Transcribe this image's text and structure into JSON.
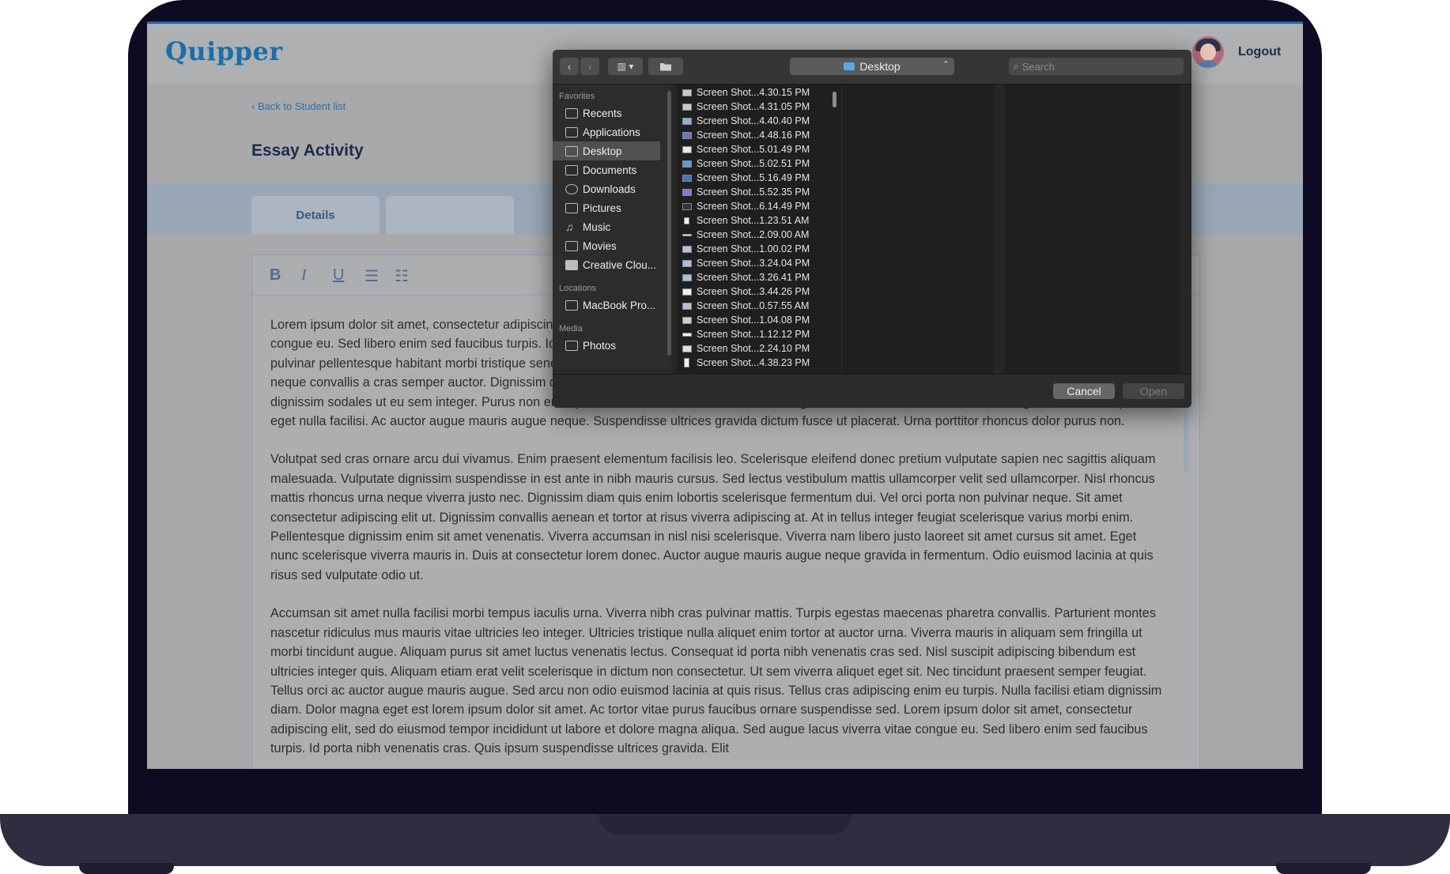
{
  "app": {
    "logo": "Quipper",
    "logout_label": "Logout",
    "back_link": "‹  Back to Student list",
    "page_title": "Essay Activity",
    "tabs": [
      {
        "label": "Details"
      },
      {
        "label": ""
      }
    ],
    "toolbar": {
      "bold": "B",
      "italic": "I",
      "underline": "U",
      "bullets": "☰",
      "numbered": "☷"
    },
    "essay": [
      "Lorem ipsum dolor sit amet, consectetur adipiscing elit, sed do eiusmod tempor incididunt ut labore et dolore magna aliqua. Sed augue lacus viverra vitae congue eu. Sed libero enim sed faucibus turpis. Id porta nibh venenatis cras. Quis ipsum suspendisse ultrices gravida. Elit scelerisque mauris pellentesque pulvinar pellentesque habitant morbi tristique senectus. Scelerisque mauris pellentesque pulvinar pellentesque habitant. Bibendum enim facilisis gravida neque convallis a cras semper auctor. Dignissim diam quis enim lobortis scelerisque fermentum dui faucibus in. Euismod in pellentesque. Nunc sed velit dignissim sodales ut eu sem integer. Purus non enim praesent elementum facilisis leo vel fringilla est. Elementum facilisis leo vel fringilla est ullamcorper eget nulla facilisi. Ac auctor augue mauris augue neque. Suspendisse ultrices gravida dictum fusce ut placerat. Urna porttitor rhoncus dolor purus non.",
      "Volutpat sed cras ornare arcu dui vivamus. Enim praesent elementum facilisis leo. Scelerisque eleifend donec pretium vulputate sapien nec sagittis aliquam malesuada. Vulputate dignissim suspendisse in est ante in nibh mauris cursus. Sed lectus vestibulum mattis ullamcorper velit sed ullamcorper. Nisl rhoncus mattis rhoncus urna neque viverra justo nec. Dignissim diam quis enim lobortis scelerisque fermentum dui. Vel orci porta non pulvinar neque. Sit amet consectetur adipiscing elit ut. Dignissim convallis aenean et tortor at risus viverra adipiscing at. At in tellus integer feugiat scelerisque varius morbi enim. Pellentesque dignissim enim sit amet venenatis. Viverra accumsan in nisl nisi scelerisque. Viverra nam libero justo laoreet sit amet cursus sit amet. Eget nunc scelerisque viverra mauris in. Duis at consectetur lorem donec. Auctor augue mauris augue neque gravida in fermentum. Odio euismod lacinia at quis risus sed vulputate odio ut.",
      "Accumsan sit amet nulla facilisi morbi tempus iaculis urna. Viverra nibh cras pulvinar mattis. Turpis egestas maecenas pharetra convallis. Parturient montes nascetur ridiculus mus mauris vitae ultricies leo integer. Ultricies tristique nulla aliquet enim tortor at auctor urna. Viverra mauris in aliquam sem fringilla ut morbi tincidunt augue. Aliquam purus sit amet luctus venenatis lectus. Consequat id porta nibh venenatis cras sed. Nisl suscipit adipiscing bibendum est ultricies integer quis. Aliquam etiam erat velit scelerisque in dictum non consectetur. Ut sem viverra aliquet eget sit. Nec tincidunt praesent semper feugiat. Tellus orci ac auctor augue mauris augue. Sed arcu non odio euismod lacinia at quis risus. Tellus cras adipiscing enim eu turpis. Nulla facilisi etiam dignissim diam. Dolor magna eget est lorem ipsum dolor sit amet. Ac tortor vitae purus faucibus ornare suspendisse sed. Lorem ipsum dolor sit amet, consectetur adipiscing elit, sed do eiusmod tempor incididunt ut labore et dolore magna aliqua. Sed augue lacus viverra vitae congue eu. Sed libero enim sed faucibus turpis. Id porta nibh venenatis cras. Quis ipsum suspendisse ultrices gravida. Elit"
    ]
  },
  "dialog": {
    "location": "Desktop",
    "search_placeholder": "Search",
    "sidebar": {
      "favorites_heading": "Favorites",
      "favorites": [
        {
          "label": "Recents",
          "icon": "clock-icon",
          "selected": false
        },
        {
          "label": "Applications",
          "icon": "applications-icon",
          "selected": false
        },
        {
          "label": "Desktop",
          "icon": "desktop-icon",
          "selected": true
        },
        {
          "label": "Documents",
          "icon": "document-icon",
          "selected": false
        },
        {
          "label": "Downloads",
          "icon": "download-icon",
          "selected": false
        },
        {
          "label": "Pictures",
          "icon": "camera-icon",
          "selected": false
        },
        {
          "label": "Music",
          "icon": "music-note-icon",
          "selected": false
        },
        {
          "label": "Movies",
          "icon": "film-icon",
          "selected": false
        },
        {
          "label": "Creative Clou...",
          "icon": "folder-icon",
          "selected": false
        }
      ],
      "locations_heading": "Locations",
      "locations": [
        {
          "label": "MacBook Pro...",
          "icon": "laptop-icon"
        }
      ],
      "media_heading": "Media",
      "media": [
        {
          "label": "Photos",
          "icon": "camera-icon"
        }
      ]
    },
    "files": [
      "Screen Shot...4.30.15 PM",
      "Screen Shot...4.31.05 PM",
      "Screen Shot...4.40.40 PM",
      "Screen Shot...4.48.16 PM",
      "Screen Shot...5.01.49 PM",
      "Screen Shot...5.02.51 PM",
      "Screen Shot...5.16.49 PM",
      "Screen Shot...5.52.35 PM",
      "Screen Shot...6.14.49 PM",
      "Screen Shot...1.23.51 AM",
      "Screen Shot...2.09.00 AM",
      "Screen Shot...1.00.02 PM",
      "Screen Shot...3.24.04 PM",
      "Screen Shot...3.26.41 PM",
      "Screen Shot...3.44.26 PM",
      "Screen Shot...0.57.55 AM",
      "Screen Shot...1.04.08 PM",
      "Screen Shot...1.12.12 PM",
      "Screen Shot...2.24.10 PM",
      "Screen Shot...4.38.23 PM"
    ],
    "cancel_label": "Cancel",
    "open_label": "Open"
  },
  "colors": {
    "brand": "#1b6fa8",
    "dialog_bg": "#262626",
    "selection": "#505050"
  }
}
